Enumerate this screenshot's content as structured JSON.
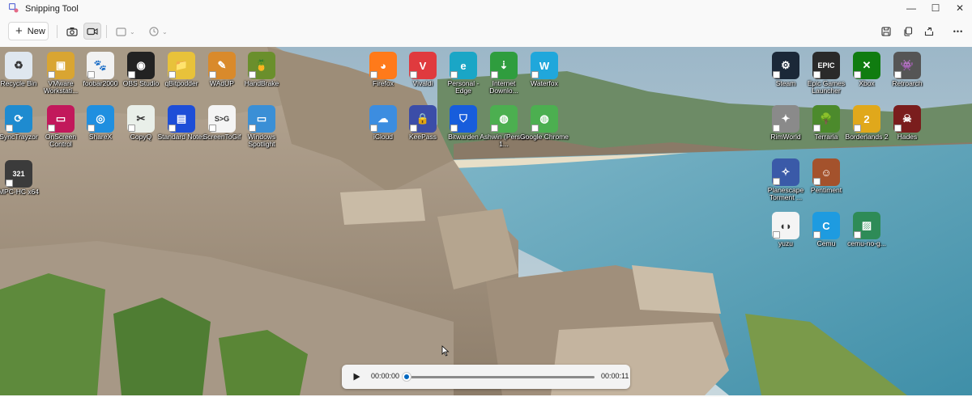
{
  "app": {
    "title": "Snipping Tool"
  },
  "window_controls": {
    "minimize": "—",
    "maximize": "☐",
    "close": "✕"
  },
  "toolbar": {
    "new_label": "New",
    "more_label": "•••"
  },
  "desktop_icons": [
    {
      "label": "Recycle Bin",
      "icon": "recycle-bin-icon",
      "color": "#dfe7ef",
      "glyph": "♻"
    },
    {
      "label": "VMware Workstati...",
      "icon": "vmware-icon",
      "color": "#d9a532",
      "glyph": "▣"
    },
    {
      "label": "foobar2000",
      "icon": "foobar-icon",
      "color": "#f2f2f2",
      "glyph": "🐾"
    },
    {
      "label": "OBS Studio",
      "icon": "obs-icon",
      "color": "#222222",
      "glyph": "◉"
    },
    {
      "label": "qBitpodder",
      "icon": "folder-icon",
      "color": "#e8c23a",
      "glyph": "📁"
    },
    {
      "label": "WAdUP",
      "icon": "wadup-icon",
      "color": "#d98a2b",
      "glyph": "✎"
    },
    {
      "label": "HandBrake",
      "icon": "handbrake-icon",
      "color": "#6a8f2c",
      "glyph": "🍍"
    },
    {
      "label": "SyncTrayzor",
      "icon": "synctrayzor-icon",
      "color": "#1e8bd0",
      "glyph": "⟳"
    },
    {
      "label": "OnScreen Control",
      "icon": "onscreen-control-icon",
      "color": "#c2185b",
      "glyph": "▭"
    },
    {
      "label": "ShareX",
      "icon": "sharex-icon",
      "color": "#1f8fe0",
      "glyph": "◎"
    },
    {
      "label": "CopyQ",
      "icon": "copyq-icon",
      "color": "#e9efe9",
      "glyph": "✂"
    },
    {
      "label": "Standard Notes",
      "icon": "standard-notes-icon",
      "color": "#1d4ed8",
      "glyph": "▤"
    },
    {
      "label": "ScreenToGif",
      "icon": "screentogif-icon",
      "color": "#f4f4f4",
      "glyph": "S>G"
    },
    {
      "label": "Windows Spotlight",
      "icon": "windows-spotlight-icon",
      "color": "#3a8fd6",
      "glyph": "▭"
    },
    {
      "label": "MPC-HC x64",
      "icon": "mpc-hc-icon",
      "color": "#3b3b3b",
      "glyph": "321"
    },
    {
      "label": "Firefox",
      "icon": "firefox-icon",
      "color": "#ff7a1a",
      "glyph": "◕"
    },
    {
      "label": "Vivaldi",
      "icon": "vivaldi-icon",
      "color": "#e03a3e",
      "glyph": "V"
    },
    {
      "label": "Personal - Edge",
      "icon": "edge-icon",
      "color": "#1aa6c6",
      "glyph": "e"
    },
    {
      "label": "Internet Downlo...",
      "icon": "idm-icon",
      "color": "#2f9d3e",
      "glyph": "⇣"
    },
    {
      "label": "Waterfox",
      "icon": "waterfox-icon",
      "color": "#20a7db",
      "glyph": "W"
    },
    {
      "label": "iCloud",
      "icon": "icloud-icon",
      "color": "#3c8de0",
      "glyph": "☁"
    },
    {
      "label": "KeePass",
      "icon": "keepass-icon",
      "color": "#3b4da8",
      "glyph": "🔒"
    },
    {
      "label": "Bitwarden",
      "icon": "bitwarden-icon",
      "color": "#175ddc",
      "glyph": "⛉"
    },
    {
      "label": "Ashwin (Person 1...",
      "icon": "chrome-profile-icon",
      "color": "#4caf50",
      "glyph": "◍"
    },
    {
      "label": "Google Chrome",
      "icon": "chrome-icon",
      "color": "#4caf50",
      "glyph": "◍"
    },
    {
      "label": "Steam",
      "icon": "steam-icon",
      "color": "#1b2838",
      "glyph": "⚙"
    },
    {
      "label": "Epic Games Launcher",
      "icon": "epic-games-icon",
      "color": "#2a2a2a",
      "glyph": "EPIC"
    },
    {
      "label": "Xbox",
      "icon": "xbox-icon",
      "color": "#107c10",
      "glyph": "✕"
    },
    {
      "label": "Retroarch",
      "icon": "retroarch-icon",
      "color": "#555555",
      "glyph": "👾"
    },
    {
      "label": "RimWorld",
      "icon": "rimworld-icon",
      "color": "#8a8a8a",
      "glyph": "✦"
    },
    {
      "label": "Terraria",
      "icon": "terraria-icon",
      "color": "#4c8a2c",
      "glyph": "🌳"
    },
    {
      "label": "Borderlands 2",
      "icon": "borderlands-icon",
      "color": "#e0a81b",
      "glyph": "2"
    },
    {
      "label": "Hades",
      "icon": "hades-icon",
      "color": "#7a1d1d",
      "glyph": "☠"
    },
    {
      "label": "Planescape Torment ...",
      "icon": "planescape-icon",
      "color": "#3a5aa8",
      "glyph": "✧"
    },
    {
      "label": "Pentiment",
      "icon": "pentiment-icon",
      "color": "#a4522c",
      "glyph": "☺"
    },
    {
      "label": "yuzu",
      "icon": "yuzu-icon",
      "color": "#f4f4f4",
      "glyph": "◖◗"
    },
    {
      "label": "Cemu",
      "icon": "cemu-icon",
      "color": "#1e9be0",
      "glyph": "C"
    },
    {
      "label": "cemu-no-g...",
      "icon": "cemu-nog-icon",
      "color": "#2e8b57",
      "glyph": "▨"
    }
  ],
  "player": {
    "current_time": "00:00:00",
    "total_time": "00:00:11",
    "progress": 0
  }
}
